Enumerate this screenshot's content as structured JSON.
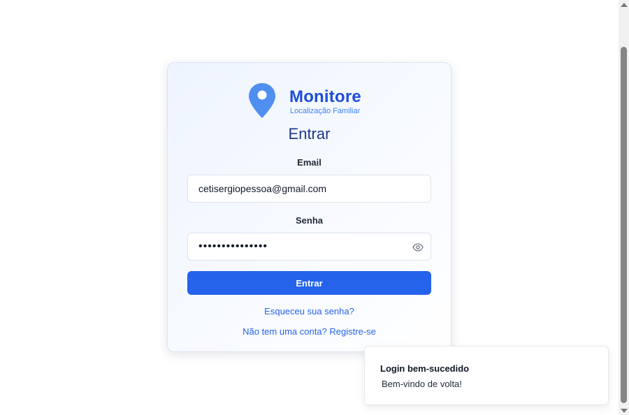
{
  "brand": {
    "name": "Monitore",
    "subtitle": "Localização Familiar",
    "accent": "#2563eb",
    "icon": "map-pin-icon"
  },
  "login": {
    "title": "Entrar",
    "email_label": "Email",
    "email_value": "cetisergiopessoa@gmail.com",
    "password_label": "Senha",
    "password_value": "•••••••••••••••",
    "show_password_icon": "eye-icon",
    "submit_label": "Entrar",
    "forgot_link": "Esqueceu sua senha?",
    "register_link": "Não tem uma conta? Registre-se"
  },
  "toast": {
    "title": "Login bem-sucedido",
    "message": "Bem-vindo de volta!"
  }
}
